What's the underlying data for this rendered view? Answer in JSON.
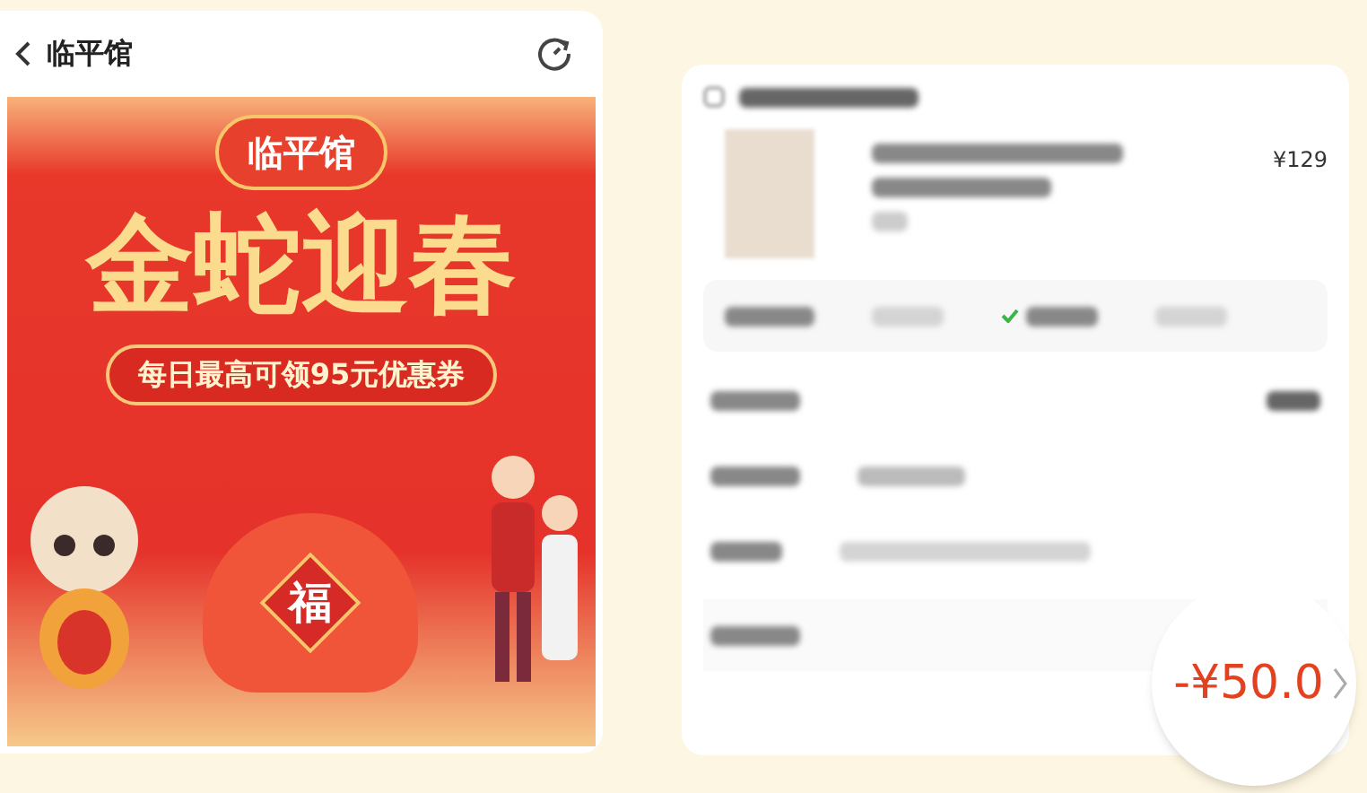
{
  "header": {
    "title": "临平馆"
  },
  "banner": {
    "badge": "临平馆",
    "headline": "金蛇迎春",
    "coupon_text": "每日最高可领95元优惠券",
    "bag_label": "福"
  },
  "order": {
    "price": "¥129",
    "delivery_options": [
      {
        "selected": false
      },
      {
        "selected": true
      },
      {
        "selected": false
      }
    ],
    "magnifier": {
      "discount": "-¥50.0"
    }
  }
}
